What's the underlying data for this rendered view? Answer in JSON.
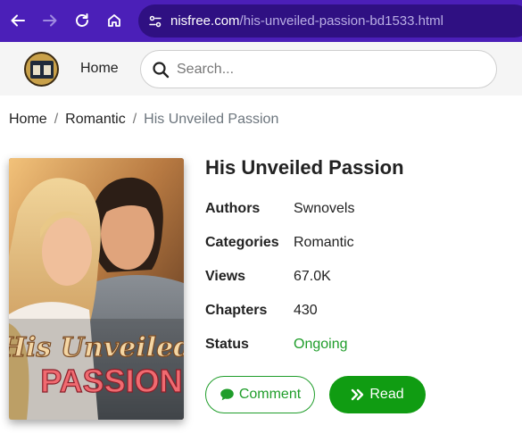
{
  "browser": {
    "url_domain": "nisfree.com",
    "url_path": "/his-unveiled-passion-bd1533.html",
    "back_icon": "arrow-left-icon",
    "forward_icon": "arrow-right-icon",
    "reload_icon": "reload-icon",
    "home_icon": "home-icon",
    "site_info_icon": "site-settings-icon"
  },
  "header": {
    "home_label": "Home",
    "search_placeholder": "Search..."
  },
  "breadcrumb": {
    "items": [
      "Home",
      "Romantic"
    ],
    "current": "His Unveiled Passion"
  },
  "book": {
    "title": "His Unveiled Passion",
    "cover_title_line1": "His Unveiled",
    "cover_title_line2": "PASSION",
    "details": [
      {
        "label": "Authors",
        "value": "Swnovels"
      },
      {
        "label": "Categories",
        "value": "Romantic"
      },
      {
        "label": "Views",
        "value": "67.0K"
      },
      {
        "label": "Chapters",
        "value": "430"
      },
      {
        "label": "Status",
        "value": "Ongoing"
      }
    ]
  },
  "actions": {
    "comment_label": "Comment",
    "read_label": "Read"
  },
  "colors": {
    "browser_bar": "#4b1fb8",
    "accent_green": "#109c12",
    "status_green": "#1f9d2a"
  }
}
